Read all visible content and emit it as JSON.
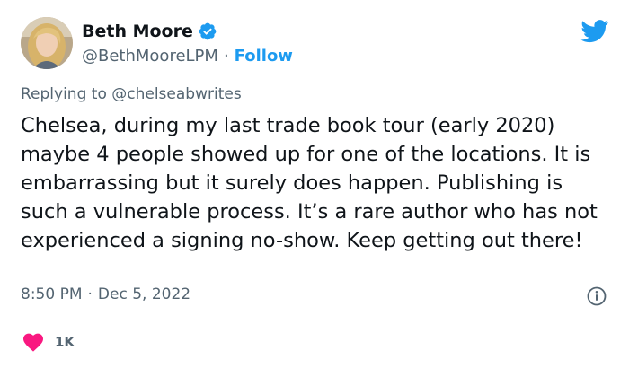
{
  "author": {
    "display_name": "Beth Moore",
    "handle": "@BethMooreLPM",
    "separator": "·",
    "follow_label": "Follow"
  },
  "reply": {
    "prefix": "Replying to",
    "mention": "@chelseabwrites"
  },
  "tweet": {
    "text": "Chelsea, during my last trade book tour (early 2020) maybe 4 people showed up for one of the locations. It is embarrassing but it surely does happen. Publishing is such a vulnerable process. It’s a rare author who has not experienced a signing no-show. Keep getting out there!",
    "time": "8:50 PM",
    "date_separator": "·",
    "date": "Dec 5, 2022"
  },
  "engagement": {
    "likes": "1K"
  },
  "icons": {
    "verified": "verified-badge-icon",
    "platform": "twitter-bird-icon",
    "info": "info-icon",
    "like": "heart-icon"
  },
  "colors": {
    "accent": "#1d9bf0",
    "text": "#0f1419",
    "muted": "#536471",
    "heart": "#f91880"
  }
}
